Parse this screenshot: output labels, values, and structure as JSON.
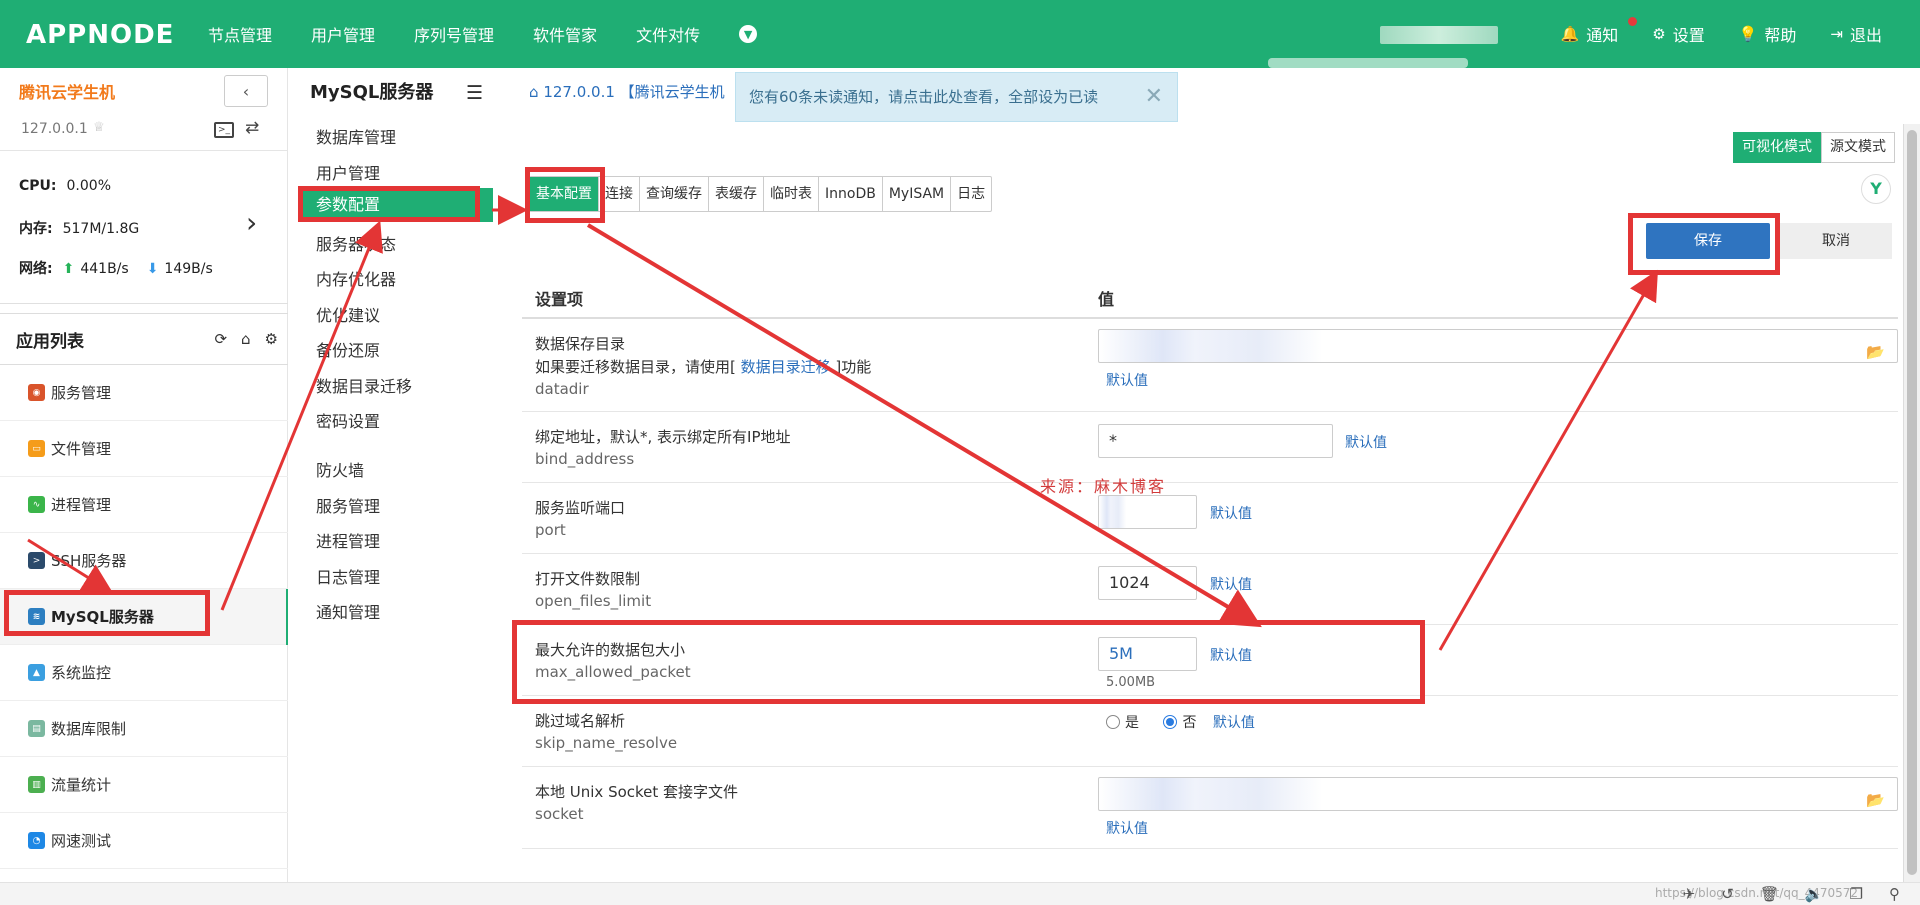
{
  "topbar": {
    "logo": "APPNODE",
    "nav": [
      "节点管理",
      "用户管理",
      "序列号管理",
      "软件管家",
      "文件对传"
    ],
    "right": [
      {
        "icon": "bell-icon",
        "label": "通知"
      },
      {
        "icon": "gear-icon",
        "label": "设置"
      },
      {
        "icon": "lightbulb-icon",
        "label": "帮助"
      },
      {
        "icon": "logout-icon",
        "label": "退出"
      }
    ]
  },
  "server": {
    "name": "腾讯云学生机",
    "ip": "127.0.0.1",
    "cpu_label": "CPU:",
    "cpu": "0.00%",
    "mem_label": "内存:",
    "mem": "517M/1.8G",
    "net_label": "网络:",
    "net_up": "441B/s",
    "net_down": "149B/s"
  },
  "applist": {
    "title": "应用列表",
    "items": [
      {
        "label": "服务管理",
        "color": "#d9542b"
      },
      {
        "label": "文件管理",
        "color": "#f59c1a"
      },
      {
        "label": "进程管理",
        "color": "#3bb54a"
      },
      {
        "label": "SSH服务器",
        "color": "#2b4a6b"
      },
      {
        "label": "MySQL服务器",
        "color": "#2d7fc1"
      },
      {
        "label": "系统监控",
        "color": "#3b9fe0"
      },
      {
        "label": "数据库限制",
        "color": "#7bb8a0"
      },
      {
        "label": "流量统计",
        "color": "#4caf50"
      },
      {
        "label": "网速测试",
        "color": "#1e88e5"
      }
    ]
  },
  "midmenu": {
    "title": "MySQL服务器",
    "items": [
      "数据库管理",
      "用户管理",
      "参数配置",
      "服务器状态",
      "内存优化器",
      "优化建议",
      "备份还原",
      "数据目录迁移",
      "密码设置"
    ],
    "items2": [
      "防火墙",
      "服务管理",
      "进程管理",
      "日志管理",
      "通知管理"
    ]
  },
  "main": {
    "breadcrumb": "127.0.0.1 【腾讯云学生机",
    "notice": "您有60条未读通知，请点击此处查看，全部设为已读",
    "mode_visual": "可视化模式",
    "mode_source": "源文模式",
    "tabs": [
      "基本配置",
      "连接",
      "查询缓存",
      "表缓存",
      "临时表",
      "InnoDB",
      "MyISAM",
      "日志"
    ],
    "save": "保存",
    "cancel": "取消",
    "col_setting": "设置项",
    "col_value": "值",
    "default_link": "默认值",
    "rows": [
      {
        "label": "数据保存目录",
        "desc_pre": "如果要迁移数据目录，请使用[ ",
        "desc_link": "数据目录迁移",
        "desc_post": " ]功能",
        "key": "datadir"
      },
      {
        "label": "绑定地址，默认*, 表示绑定所有IP地址",
        "key": "bind_address",
        "value": "*"
      },
      {
        "label": "服务监听端口",
        "key": "port"
      },
      {
        "label": "打开文件数限制",
        "key": "open_files_limit",
        "value": "1024"
      },
      {
        "label": "最大允许的数据包大小",
        "key": "max_allowed_packet",
        "value": "5M",
        "hint": "5.00MB"
      },
      {
        "label": "跳过域名解析",
        "key": "skip_name_resolve",
        "opt_yes": "是",
        "opt_no": "否"
      },
      {
        "label": "本地 Unix Socket 套接字文件",
        "key": "socket"
      }
    ],
    "watermark": "来源：麻木博客"
  },
  "footer": {
    "url": "https://blog.csdn.net/qq_4470572"
  }
}
